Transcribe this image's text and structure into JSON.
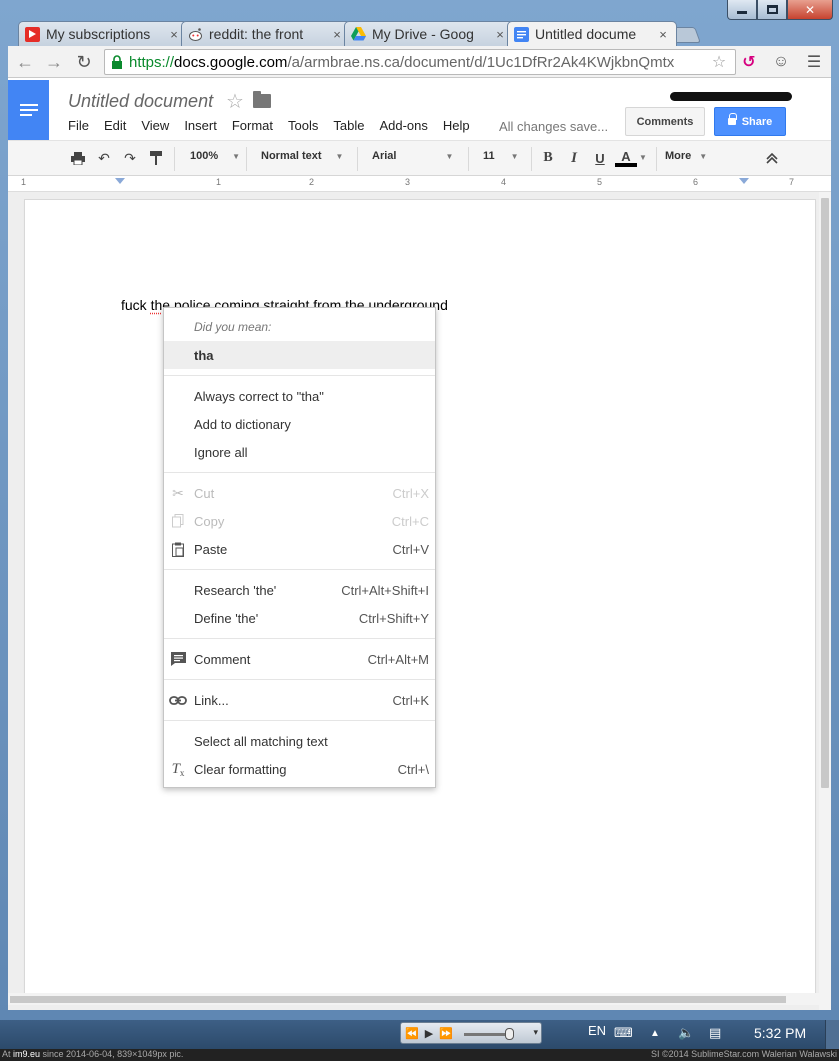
{
  "tabs": [
    {
      "title": "My subscriptions",
      "favicon": "youtube-icon"
    },
    {
      "title": "reddit: the front",
      "favicon": "reddit-icon"
    },
    {
      "title": "My Drive - Goog",
      "favicon": "drive-icon"
    },
    {
      "title": "Untitled docume",
      "favicon": "docs-icon",
      "active": true
    }
  ],
  "tab_close_glyph": "×",
  "window_close_glyph": "✕",
  "address": {
    "scheme": "https://",
    "host": "docs.google.com",
    "path": "/a/armbrae.ns.ca/document/d/1Uc1DfRr2Ak4KWjkbnQmtx"
  },
  "docs": {
    "title": "Untitled document",
    "menu": [
      "File",
      "Edit",
      "View",
      "Insert",
      "Format",
      "Tools",
      "Table",
      "Add-ons",
      "Help"
    ],
    "save_status": "All changes save...",
    "comments_label": "Comments",
    "share_label": "Share"
  },
  "format_toolbar": {
    "zoom": "100%",
    "style": "Normal text",
    "font": "Arial",
    "size": "11",
    "bold": "B",
    "italic": "I",
    "underline": "U",
    "text_color": "A",
    "more": "More"
  },
  "ruler": [
    "1",
    "1",
    "2",
    "3",
    "4",
    "5",
    "6",
    "7"
  ],
  "document": {
    "before": "fuck ",
    "misspelled": "th",
    "after": "e police coming straight from the underground"
  },
  "context_menu": {
    "did_you_mean": "Did you mean:",
    "suggestion": "tha",
    "always_correct": "Always correct to \"tha\"",
    "add_dictionary": "Add to dictionary",
    "ignore_all": "Ignore all",
    "cut": {
      "label": "Cut",
      "shortcut": "Ctrl+X"
    },
    "copy": {
      "label": "Copy",
      "shortcut": "Ctrl+C"
    },
    "paste": {
      "label": "Paste",
      "shortcut": "Ctrl+V"
    },
    "research": {
      "label": "Research 'the'",
      "shortcut": "Ctrl+Alt+Shift+I"
    },
    "define": {
      "label": "Define 'the'",
      "shortcut": "Ctrl+Shift+Y"
    },
    "comment": {
      "label": "Comment",
      "shortcut": "Ctrl+Alt+M"
    },
    "link": {
      "label": "Link...",
      "shortcut": "Ctrl+K"
    },
    "select_matching": "Select all matching text",
    "clear_formatting": {
      "label": "Clear formatting",
      "shortcut": "Ctrl+\\"
    }
  },
  "taskbar": {
    "language": "EN",
    "time": "5:32 PM"
  },
  "watermark": {
    "left_prefix": "At ",
    "left_site": "im9.eu",
    "left_rest": " since 2014-06-04, 839×1049px pic.",
    "right": "SI ©2014 SublimeStar.com Walerian Walawski"
  },
  "colors": {
    "docs_blue": "#4285f4",
    "share_blue": "#4d90fe",
    "https_green": "#0a8a2d"
  }
}
